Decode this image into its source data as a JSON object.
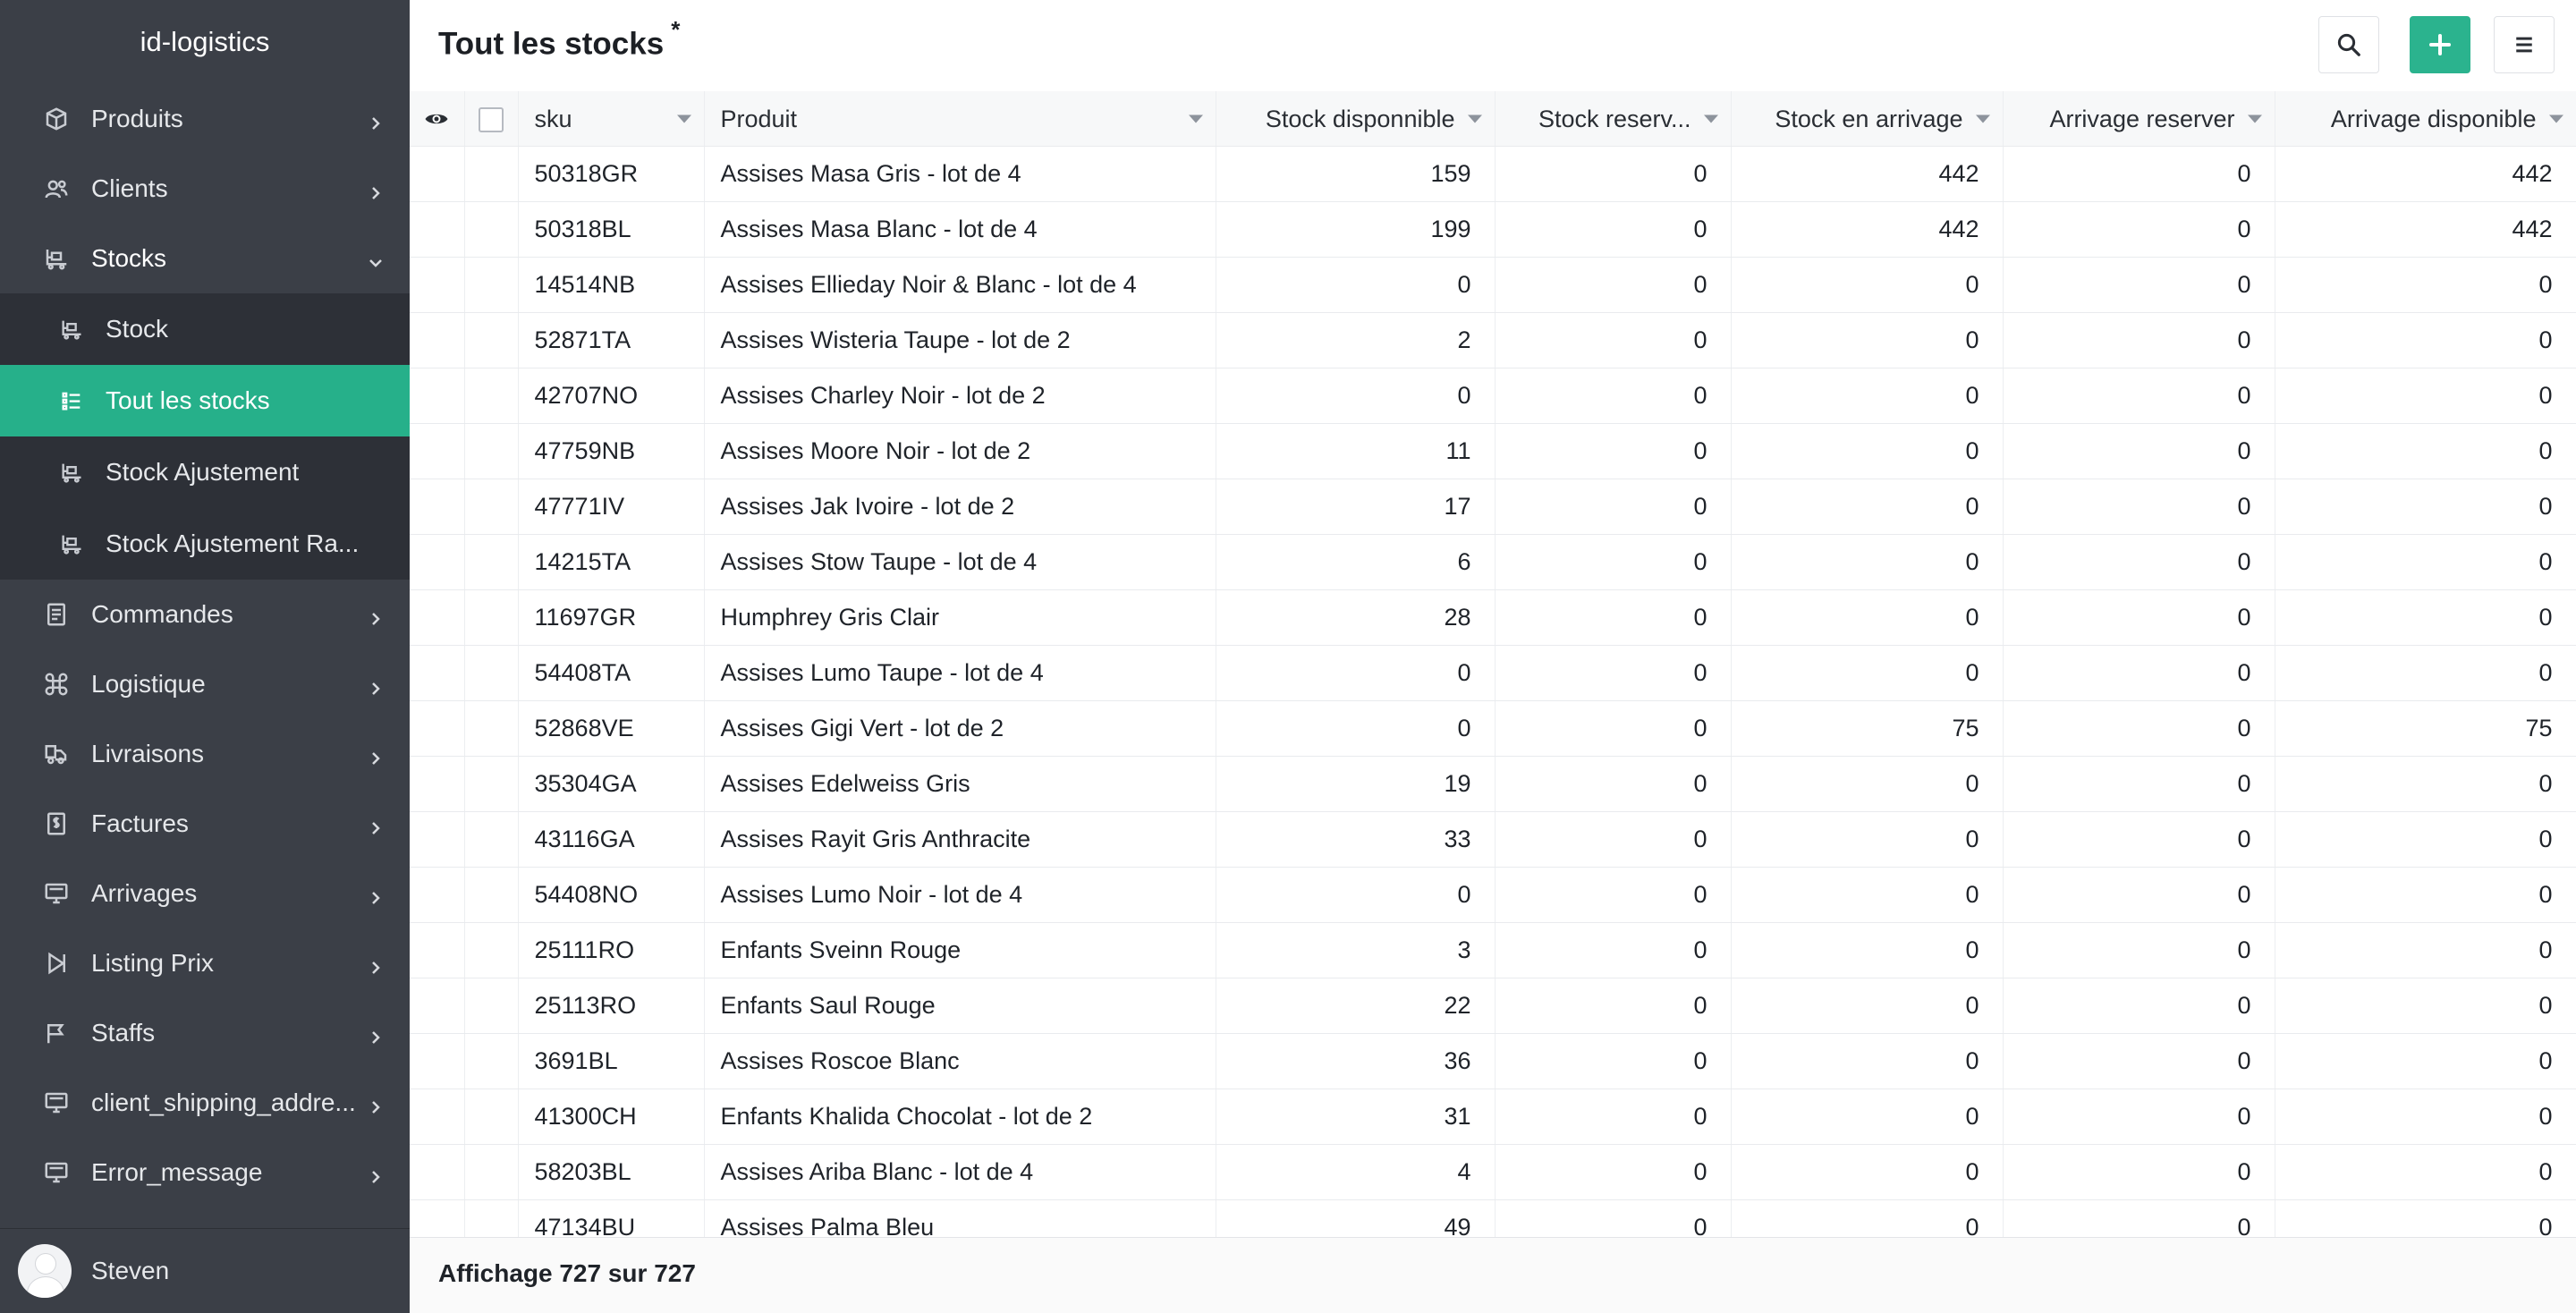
{
  "app": {
    "brand": "id-logistics"
  },
  "sidebar": {
    "items": [
      {
        "label": "Produits",
        "icon": "box-icon"
      },
      {
        "label": "Clients",
        "icon": "users-icon"
      },
      {
        "label": "Stocks",
        "icon": "warehouse-icon",
        "open": true,
        "children": [
          {
            "label": "Stock",
            "icon": "warehouse-icon"
          },
          {
            "label": "Tout les stocks",
            "icon": "list-icon",
            "active": true
          },
          {
            "label": "Stock Ajustement",
            "icon": "warehouse-icon"
          },
          {
            "label": "Stock Ajustement Ra...",
            "icon": "warehouse-icon"
          }
        ]
      },
      {
        "label": "Commandes",
        "icon": "clipboard-icon"
      },
      {
        "label": "Logistique",
        "icon": "command-icon"
      },
      {
        "label": "Livraisons",
        "icon": "truck-icon"
      },
      {
        "label": "Factures",
        "icon": "invoice-icon"
      },
      {
        "label": "Arrivages",
        "icon": "monitor-icon"
      },
      {
        "label": "Listing Prix",
        "icon": "play-icon"
      },
      {
        "label": "Staffs",
        "icon": "flag-icon"
      },
      {
        "label": "client_shipping_addre...",
        "icon": "monitor-icon"
      },
      {
        "label": "Error_message",
        "icon": "monitor-icon"
      }
    ]
  },
  "user": {
    "name": "Steven"
  },
  "header": {
    "title": "Tout les stocks",
    "modified_marker": "*"
  },
  "table": {
    "columns": [
      "sku",
      "Produit",
      "Stock disponnible",
      "Stock reserv...",
      "Stock en arrivage",
      "Arrivage reserver",
      "Arrivage disponible"
    ],
    "rows": [
      [
        "50318GR",
        "Assises Masa Gris - lot de 4",
        "159",
        "0",
        "442",
        "0",
        "442"
      ],
      [
        "50318BL",
        "Assises Masa Blanc - lot de 4",
        "199",
        "0",
        "442",
        "0",
        "442"
      ],
      [
        "14514NB",
        "Assises Ellieday Noir & Blanc - lot de 4",
        "0",
        "0",
        "0",
        "0",
        "0"
      ],
      [
        "52871TA",
        "Assises Wisteria Taupe - lot de 2",
        "2",
        "0",
        "0",
        "0",
        "0"
      ],
      [
        "42707NO",
        "Assises Charley Noir - lot de 2",
        "0",
        "0",
        "0",
        "0",
        "0"
      ],
      [
        "47759NB",
        "Assises Moore Noir - lot de 2",
        "11",
        "0",
        "0",
        "0",
        "0"
      ],
      [
        "47771IV",
        "Assises Jak Ivoire - lot de 2",
        "17",
        "0",
        "0",
        "0",
        "0"
      ],
      [
        "14215TA",
        "Assises Stow Taupe - lot de 4",
        "6",
        "0",
        "0",
        "0",
        "0"
      ],
      [
        "11697GR",
        "Humphrey Gris Clair",
        "28",
        "0",
        "0",
        "0",
        "0"
      ],
      [
        "54408TA",
        "Assises Lumo Taupe - lot de 4",
        "0",
        "0",
        "0",
        "0",
        "0"
      ],
      [
        "52868VE",
        "Assises Gigi Vert - lot de 2",
        "0",
        "0",
        "75",
        "0",
        "75"
      ],
      [
        "35304GA",
        "Assises Edelweiss Gris",
        "19",
        "0",
        "0",
        "0",
        "0"
      ],
      [
        "43116GA",
        "Assises Rayit Gris Anthracite",
        "33",
        "0",
        "0",
        "0",
        "0"
      ],
      [
        "54408NO",
        "Assises Lumo Noir - lot de 4",
        "0",
        "0",
        "0",
        "0",
        "0"
      ],
      [
        "25111RO",
        "Enfants Sveinn Rouge",
        "3",
        "0",
        "0",
        "0",
        "0"
      ],
      [
        "25113RO",
        "Enfants Saul Rouge",
        "22",
        "0",
        "0",
        "0",
        "0"
      ],
      [
        "3691BL",
        "Assises Roscoe Blanc",
        "36",
        "0",
        "0",
        "0",
        "0"
      ],
      [
        "41300CH",
        "Enfants Khalida Chocolat - lot de 2",
        "31",
        "0",
        "0",
        "0",
        "0"
      ],
      [
        "58203BL",
        "Assises Ariba Blanc - lot de 4",
        "4",
        "0",
        "0",
        "0",
        "0"
      ],
      [
        "47134BU",
        "Assises Palma Bleu",
        "49",
        "0",
        "0",
        "0",
        "0"
      ]
    ]
  },
  "footer": {
    "count_text": "Affichage 727 sur 727"
  },
  "colors": {
    "sidebar_bg": "#3b3f47",
    "submenu_bg": "#2d3037",
    "accent": "#26b08a"
  }
}
